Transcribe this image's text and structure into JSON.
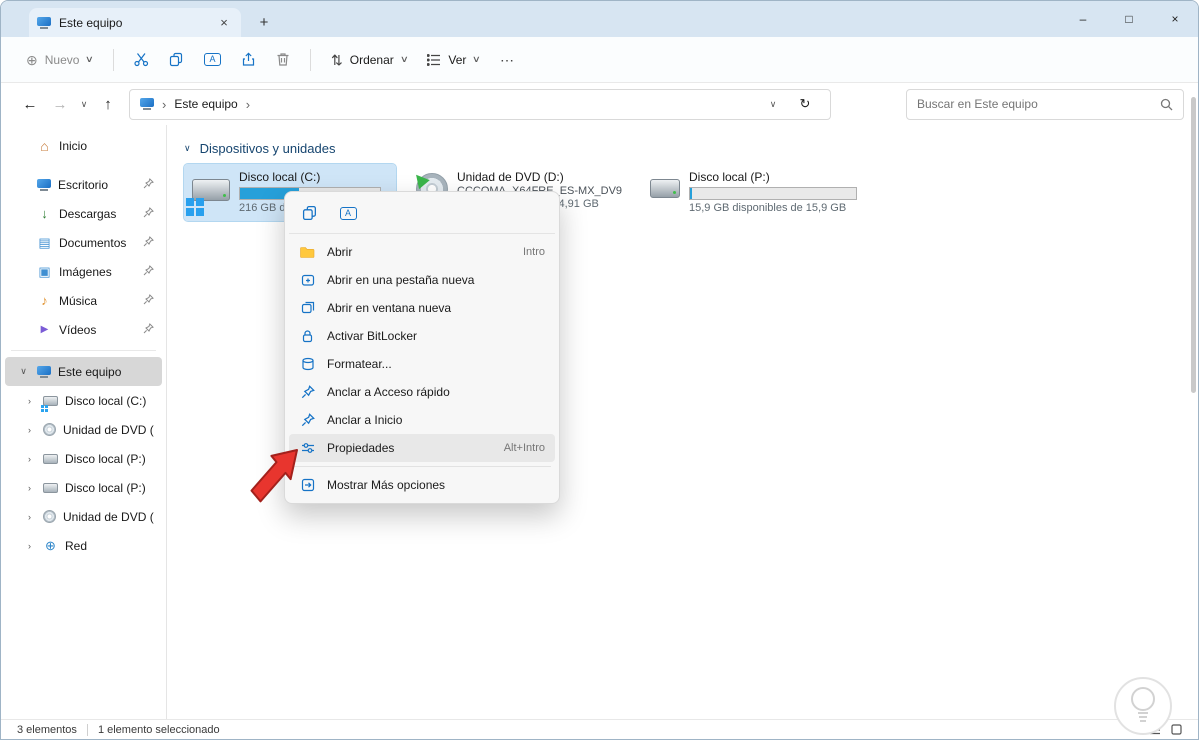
{
  "colors": {
    "accent_blue": "#1673c6",
    "titlebar": "#d7e5f2",
    "selection_blue": "#cfe5f7",
    "progress_fill": "#26a0da",
    "arrow_red": "#e8352e",
    "arrow_red_dark": "#a3211c"
  },
  "window": {
    "tab_title": "Este equipo",
    "tab_close": "×",
    "new_tab": "+",
    "controls": {
      "minimize": "–",
      "maximize": "□",
      "close": "×"
    }
  },
  "glyphs": {
    "new_circle_plus": "⊕",
    "caret_down": "∨",
    "sort_arrows": "⇅",
    "more_ellipsis": "⋯",
    "back": "←",
    "forward": "→",
    "up": "↑",
    "refresh": "↻",
    "crumb_sep": "›",
    "chevron_down": "∨",
    "chevron_right": "›",
    "home": "⌂",
    "download": "↓",
    "documents": "▤",
    "pictures": "▣",
    "music": "♪",
    "video": "▶",
    "globe": "⊕",
    "rename_letter": "A"
  },
  "toolbar": {
    "new_label": "Nuevo",
    "sort_label": "Ordenar",
    "view_label": "Ver"
  },
  "address": {
    "root": "Este equipo",
    "search_placeholder": "Buscar en Este equipo"
  },
  "sidebar": {
    "home": {
      "label": "Inicio"
    },
    "pinned": [
      {
        "label": "Escritorio"
      },
      {
        "label": "Descargas"
      },
      {
        "label": "Documentos"
      },
      {
        "label": "Imágenes"
      },
      {
        "label": "Música"
      },
      {
        "label": "Vídeos"
      }
    ],
    "computer": {
      "label": "Este equipo"
    },
    "tree": [
      {
        "label": "Disco local (C:)"
      },
      {
        "label": "Unidad de DVD (D:)"
      },
      {
        "label": "Disco local (P:)"
      },
      {
        "label": "Disco local (P:)"
      },
      {
        "label": "Unidad de DVD (D:)"
      },
      {
        "label": "Red"
      }
    ]
  },
  "main": {
    "section_title": "Dispositivos y unidades",
    "drives": [
      {
        "name": "Disco local (C:)",
        "info": "216 GB disp",
        "usage_pct": 42
      },
      {
        "name": "Unidad de DVD (D:)",
        "volume": "CCCOMA_X64FRE_ES-MX_DV9",
        "info": "0 GB disponibles de 4,91 GB"
      },
      {
        "name": "Disco local (P:)",
        "info": "15,9 GB disponibles de 15,9 GB",
        "usage_pct": 1
      }
    ]
  },
  "context_menu": {
    "items": [
      {
        "label": "Abrir",
        "shortcut": "Intro"
      },
      {
        "label": "Abrir en una pestaña nueva",
        "shortcut": ""
      },
      {
        "label": "Abrir en ventana nueva",
        "shortcut": ""
      },
      {
        "label": "Activar BitLocker",
        "shortcut": ""
      },
      {
        "label": "Formatear...",
        "shortcut": ""
      },
      {
        "label": "Anclar a Acceso rápido",
        "shortcut": ""
      },
      {
        "label": "Anclar a Inicio",
        "shortcut": ""
      },
      {
        "label": "Propiedades",
        "shortcut": "Alt+Intro"
      },
      {
        "label": "Mostrar Más opciones",
        "shortcut": ""
      }
    ]
  },
  "status": {
    "count": "3 elementos",
    "selected": "1 elemento seleccionado"
  }
}
